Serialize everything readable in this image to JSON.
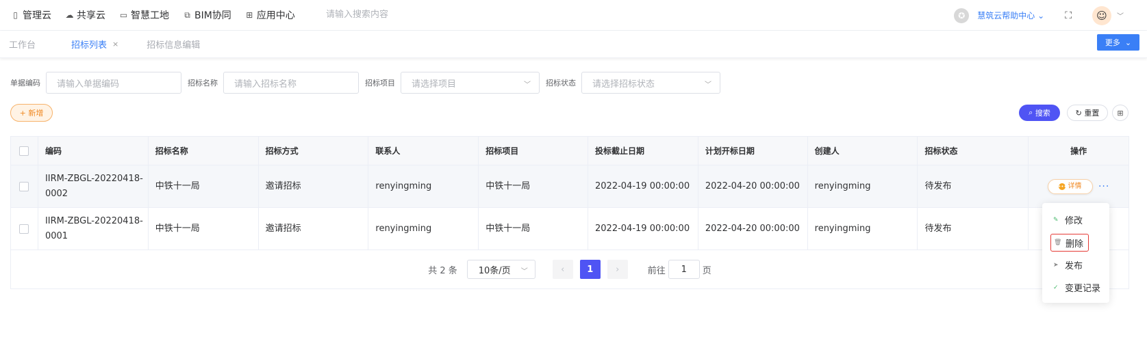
{
  "topnav": {
    "items": [
      {
        "label": "管理云",
        "icon": "book-icon"
      },
      {
        "label": "共享云",
        "icon": "cloud-icon"
      },
      {
        "label": "智慧工地",
        "icon": "monitor-icon"
      },
      {
        "label": "BIM协同",
        "icon": "bim-icon"
      },
      {
        "label": "应用中心",
        "icon": "grid-icon"
      }
    ],
    "search_placeholder": "请输入搜索内容",
    "help_label": "慧筑云帮助中心"
  },
  "tabs": [
    {
      "label": "工作台"
    },
    {
      "label": "招标列表"
    },
    {
      "label": "招标信息编辑"
    }
  ],
  "more_label": "更多",
  "filters": [
    {
      "label": "单据编码",
      "placeholder": "请输入单据编码"
    },
    {
      "label": "招标名称",
      "placeholder": "请输入招标名称"
    },
    {
      "label": "招标项目",
      "placeholder": "请选择项目"
    },
    {
      "label": "招标状态",
      "placeholder": "请选择招标状态"
    }
  ],
  "actions": {
    "add": "+ 新增",
    "search": "搜索",
    "reset": "重置"
  },
  "table": {
    "columns": [
      "编码",
      "招标名称",
      "招标方式",
      "联系人",
      "招标项目",
      "投标截止日期",
      "计划开标日期",
      "创建人",
      "招标状态",
      "操作"
    ],
    "rows": [
      {
        "code": "IIRM-ZBGL-20220418-0002",
        "name": "中铁十一局",
        "method": "邀请招标",
        "contact": "renyingming",
        "project": "中铁十一局",
        "deadline": "2022-04-19 00:00:00",
        "open_date": "2022-04-20 00:00:00",
        "creator": "renyingming",
        "status": "待发布"
      },
      {
        "code": "IIRM-ZBGL-20220418-0001",
        "name": "中铁十一局",
        "method": "邀请招标",
        "contact": "renyingming",
        "project": "中铁十一局",
        "deadline": "2022-04-19 00:00:00",
        "open_date": "2022-04-20 00:00:00",
        "creator": "renyingming",
        "status": "待发布"
      }
    ],
    "detail_label": "详情"
  },
  "pagination": {
    "total": "共 2 条",
    "page_size": "10条/页",
    "current_page": "1",
    "goto_label": "前往",
    "goto_value": "1",
    "page_suffix": "页"
  },
  "dropdown": {
    "items": [
      {
        "label": "修改",
        "icon": "edit-icon"
      },
      {
        "label": "删除",
        "icon": "trash-icon"
      },
      {
        "label": "发布",
        "icon": "send-icon"
      },
      {
        "label": "变更记录",
        "icon": "check-circle-icon"
      }
    ]
  },
  "colors": {
    "primary": "#3a7ff6",
    "accent_purple": "#4f54f4",
    "add_orange": "#f08a24",
    "delete_border": "#e53935"
  }
}
